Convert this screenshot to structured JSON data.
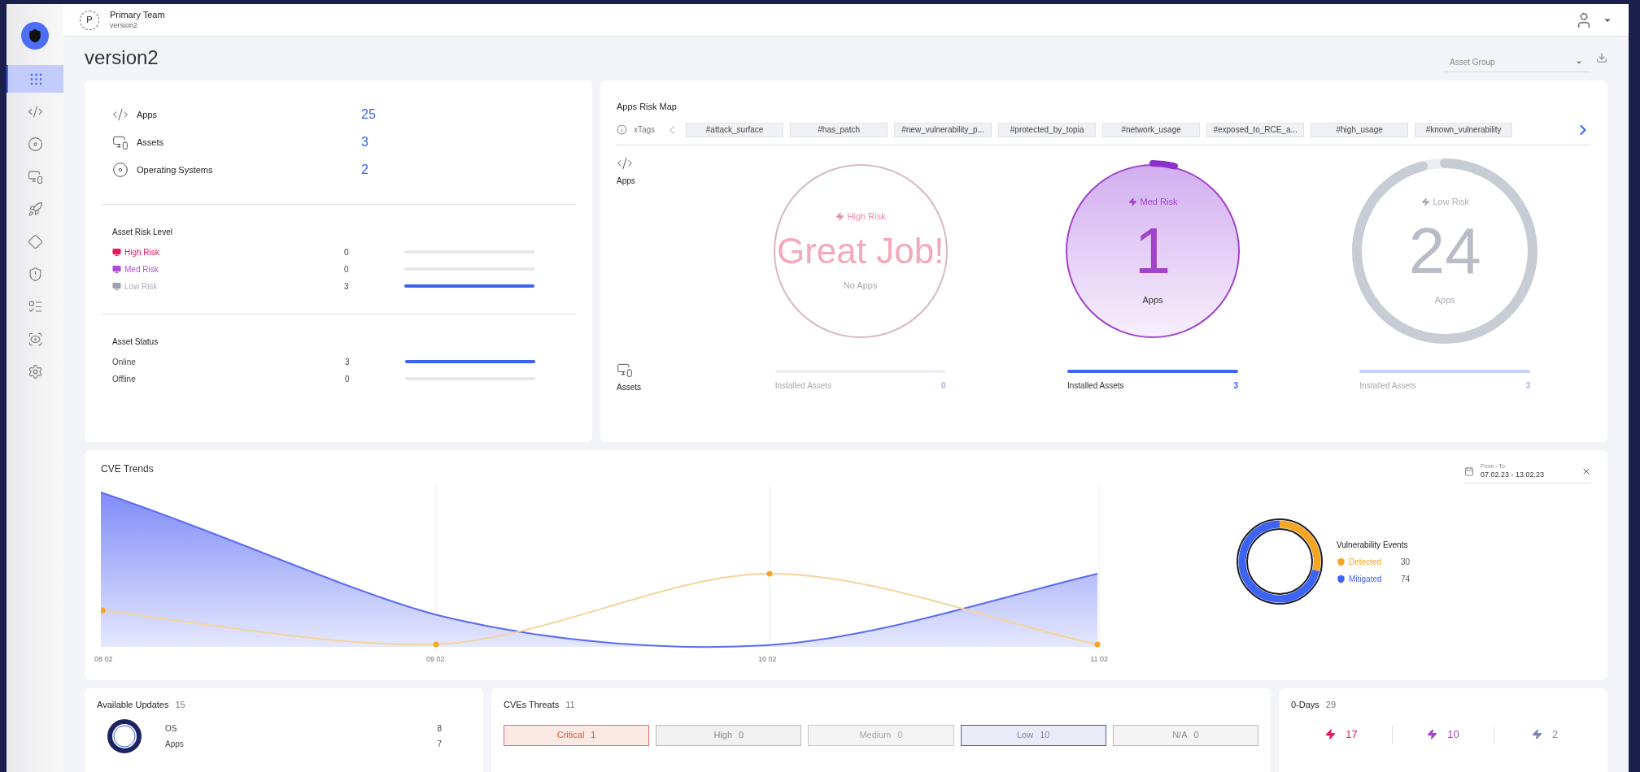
{
  "top_bar": {
    "avatar": "P",
    "team": "Primary Team",
    "workspace": "version2"
  },
  "sidebar": {
    "items": [
      {
        "kind": "grid",
        "selected": true
      },
      {
        "kind": "code",
        "selected": false
      },
      {
        "kind": "os",
        "selected": false
      },
      {
        "kind": "devices",
        "selected": false
      },
      {
        "kind": "rocket",
        "selected": false
      },
      {
        "kind": "diamond",
        "selected": false
      },
      {
        "kind": "shield",
        "selected": false
      },
      {
        "kind": "list",
        "selected": false
      },
      {
        "kind": "eye",
        "selected": false
      },
      {
        "kind": "settings",
        "selected": false
      }
    ]
  },
  "page_title": "version2",
  "asset_group": {
    "placeholder": "Asset Group"
  },
  "summary": [
    {
      "kind": "apps",
      "label": "Apps",
      "value": "25"
    },
    {
      "kind": "assets",
      "label": "Assets",
      "value": "3"
    },
    {
      "kind": "os",
      "label": "Operating Systems",
      "value": "2"
    }
  ],
  "risk_level": {
    "title": "Asset Risk Level",
    "rows": [
      {
        "kind": "high",
        "label": "High Risk",
        "value": "0"
      },
      {
        "kind": "med",
        "label": "Med Risk",
        "value": "0"
      },
      {
        "kind": "low",
        "label": "Low Risk",
        "value": "3",
        "level": 1
      }
    ]
  },
  "asset_status": {
    "title": "Asset Status",
    "rows": [
      {
        "label": "Online",
        "value": "3",
        "level": 1
      },
      {
        "label": "Offline",
        "value": "0"
      }
    ]
  },
  "risk_map": {
    "title": "Apps Risk Map",
    "tags_label": "xTags",
    "tags": [
      "#attack_surface",
      "#has_patch",
      "#new_vulnerability_p...",
      "#protected_by_topia",
      "#network_usage",
      "#exposed_to_RCE_a...",
      "#high_usage",
      "#known_vulnerability"
    ],
    "apps_label": "Apps",
    "assets_label": "Assets",
    "circles": [
      {
        "kind": "high",
        "label": "High Risk",
        "big": "Great Job!",
        "sub": "No Apps",
        "assets": {
          "label": "Installed Assets",
          "value": "0"
        }
      },
      {
        "kind": "med",
        "label": "Med Risk",
        "big": "1",
        "sub": "Apps",
        "assets": {
          "label": "Installed Assets",
          "value": "3",
          "level": 1
        }
      },
      {
        "kind": "low",
        "label": "Low Risk",
        "big": "24",
        "sub": "Apps",
        "assets": {
          "label": "Installed Assets",
          "value": "3",
          "level": 1
        }
      }
    ]
  },
  "cve_trends": {
    "title": "CVE Trends",
    "date_label": "From - To",
    "date_value": "07.02.23 - 13.02.23",
    "x_labels": [
      "08 02",
      "09 02",
      "10 02",
      "11 02"
    ],
    "events": {
      "title": "Vulnerability Events",
      "items": [
        {
          "label": "Detected",
          "value": "30",
          "color": "#f5a623"
        },
        {
          "label": "Mitigated",
          "value": "74",
          "color": "#3d63f5"
        }
      ]
    }
  },
  "available_updates": {
    "title": "Available Updates",
    "count": "15",
    "rows": [
      {
        "label": "OS",
        "value": "8"
      },
      {
        "label": "Apps",
        "value": "7"
      }
    ]
  },
  "cve_threats": {
    "title": "CVEs Threats",
    "count": "11",
    "items": [
      {
        "kind": "critical",
        "label": "Critical",
        "value": "1"
      },
      {
        "kind": "high",
        "label": "High",
        "value": "0"
      },
      {
        "kind": "medium",
        "label": "Medium",
        "value": "0"
      },
      {
        "kind": "low",
        "label": "Low",
        "value": "10"
      },
      {
        "kind": "na",
        "label": "N/A",
        "value": "0"
      }
    ]
  },
  "zero_days": {
    "title": "0-Days",
    "count": "29",
    "items": [
      {
        "kind": "high",
        "value": "17"
      },
      {
        "kind": "med",
        "value": "10"
      },
      {
        "kind": "low",
        "value": "2"
      }
    ]
  }
}
